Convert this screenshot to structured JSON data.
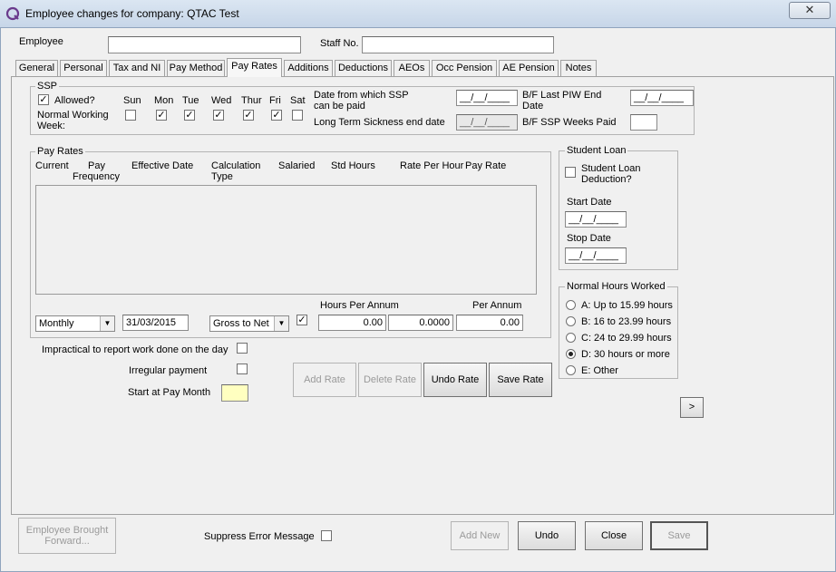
{
  "window": {
    "title": "Employee changes for company: QTAC Test",
    "close_glyph": "✕"
  },
  "header": {
    "employee_label": "Employee",
    "employee_value": "",
    "staff_label": "Staff No.",
    "staff_value": ""
  },
  "tabs": [
    "General",
    "Personal",
    "Tax and NI",
    "Pay Method",
    "Pay Rates",
    "Additions",
    "Deductions",
    "AEOs",
    "Occ Pension",
    "AE Pension",
    "Notes"
  ],
  "active_tab": "Pay Rates",
  "ssp": {
    "title": "SSP",
    "allowed_label": "Allowed?",
    "allowed_checked": true,
    "nww_label_1": "Normal Working",
    "nww_label_2": "Week:",
    "days": [
      {
        "label": "Sun",
        "checked": false
      },
      {
        "label": "Mon",
        "checked": true
      },
      {
        "label": "Tue",
        "checked": true
      },
      {
        "label": "Wed",
        "checked": true
      },
      {
        "label": "Thur",
        "checked": true
      },
      {
        "label": "Fri",
        "checked": true
      },
      {
        "label": "Sat",
        "checked": false
      }
    ],
    "date_from_label_1": "Date from which SSP",
    "date_from_label_2": "can be paid",
    "date_from_value": "__/__/____",
    "lts_label": "Long Term Sickness end date",
    "lts_value": "__/__/____",
    "bf_piw_label_1": "B/F Last PIW End",
    "bf_piw_label_2": "Date",
    "bf_piw_value": "__/__/____",
    "bf_weeks_label": "B/F SSP Weeks Paid",
    "bf_weeks_value": ""
  },
  "pay_rates": {
    "title": "Pay Rates",
    "columns": [
      "Current",
      "Pay\nFrequency",
      "Effective Date",
      "Calculation\nType",
      "Salaried",
      "Std Hours",
      "Rate Per Hour",
      "Pay Rate"
    ],
    "col_current": "Current",
    "col_pay_1": "Pay",
    "col_pay_2": "Frequency",
    "col_effective": "Effective Date",
    "col_calc_1": "Calculation",
    "col_calc_2": "Type",
    "col_salaried": "Salaried",
    "col_std_hours": "Std Hours",
    "col_rate_hour": "Rate Per Hour",
    "col_pay_rate": "Pay Rate",
    "rows": [],
    "frequency": "Monthly",
    "effective_date": "31/03/2015",
    "calc_type": "Gross to Net",
    "salaried_checked": true,
    "hours_per_annum_label": "Hours Per Annum",
    "per_annum_label": "Per Annum",
    "hours_per_annum": "0.00",
    "rate_per_hour": "0.0000",
    "per_annum": "0.00"
  },
  "options": {
    "impractical_label": "Impractical to report work done on the day",
    "irregular_label": "Irregular payment",
    "start_month_label": "Start at Pay Month",
    "start_month_value": ""
  },
  "rate_buttons": {
    "add": "Add Rate",
    "delete": "Delete Rate",
    "undo": "Undo Rate",
    "save": "Save Rate"
  },
  "student_loan": {
    "title": "Student Loan",
    "deduction_label_1": "Student Loan",
    "deduction_label_2": "Deduction?",
    "start_label": "Start Date",
    "start_value": "__/__/____",
    "stop_label": "Stop Date",
    "stop_value": "__/__/____"
  },
  "hours_worked": {
    "title": "Normal Hours Worked",
    "options": [
      {
        "label": "A: Up to 15.99 hours",
        "selected": false
      },
      {
        "label": "B: 16 to 23.99 hours",
        "selected": false
      },
      {
        "label": "C: 24 to 29.99 hours",
        "selected": false
      },
      {
        "label": "D: 30 hours or more",
        "selected": true
      },
      {
        "label": "E: Other",
        "selected": false
      }
    ]
  },
  "next_button": ">",
  "footer": {
    "brought_forward_1": "Employee Brought",
    "brought_forward_2": "Forward...",
    "suppress_label": "Suppress Error Message",
    "add_new": "Add New",
    "undo": "Undo",
    "close": "Close",
    "save": "Save"
  }
}
